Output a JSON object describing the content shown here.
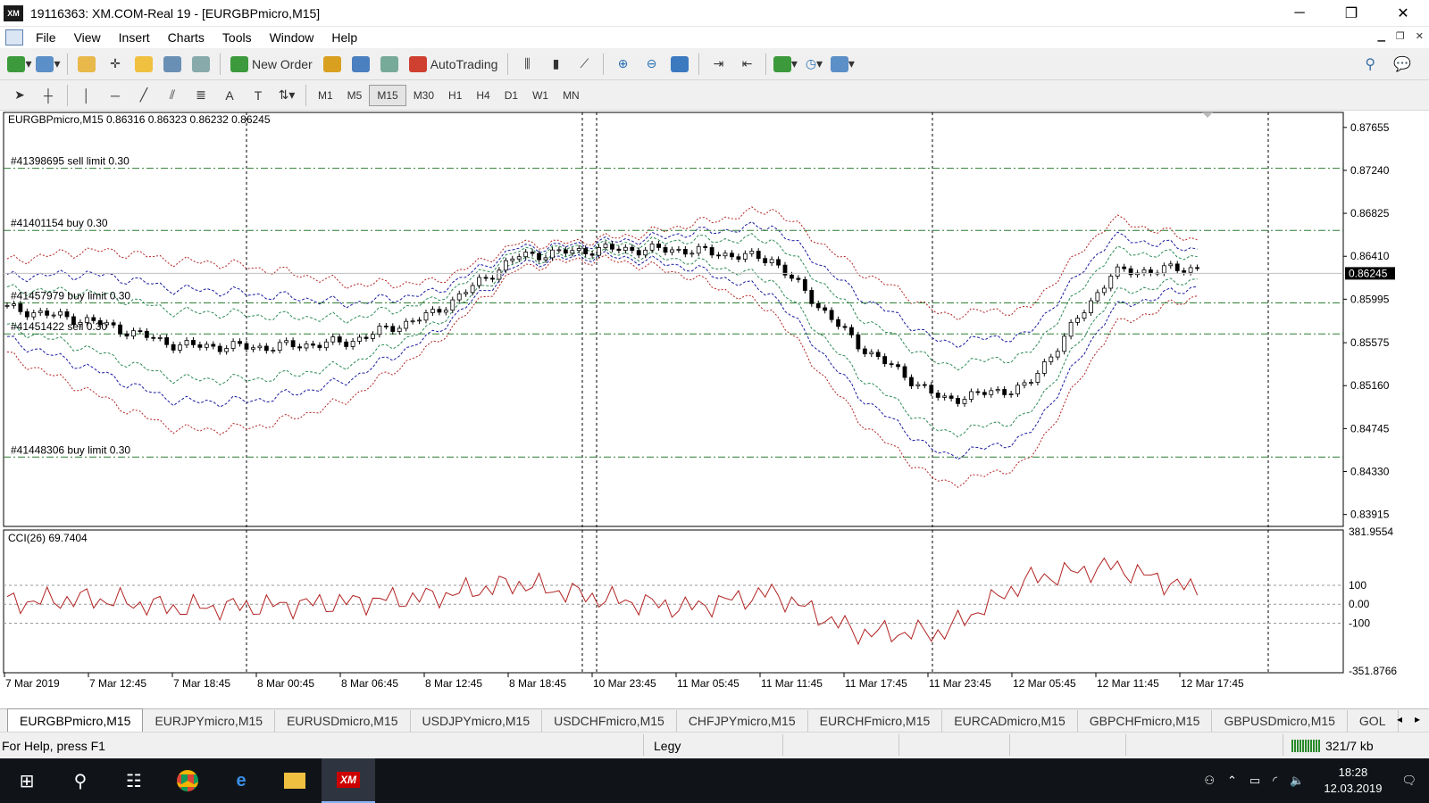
{
  "window": {
    "title": "19116363: XM.COM-Real 19 - [EURGBPmicro,M15]",
    "app_icon_text": "XM",
    "controls": [
      "─",
      "❐",
      "✕"
    ]
  },
  "menu": [
    "File",
    "View",
    "Insert",
    "Charts",
    "Tools",
    "Window",
    "Help"
  ],
  "toolbar": {
    "new_order": "New Order",
    "autotrading": "AutoTrading"
  },
  "timeframes": {
    "items": [
      "M1",
      "M5",
      "M15",
      "M30",
      "H1",
      "H4",
      "D1",
      "W1",
      "MN"
    ],
    "active": "M15"
  },
  "chart": {
    "header": "EURGBPmicro,M15  0.86316 0.86323 0.86232 0.86245",
    "current_price": "0.86245",
    "price_ticks": [
      "0.87655",
      "0.87240",
      "0.86825",
      "0.86410",
      "0.85995",
      "0.85575",
      "0.85160",
      "0.84745",
      "0.84330",
      "0.83915"
    ],
    "orders": [
      {
        "label": "#41398695 sell limit 0.30",
        "price": 0.8726
      },
      {
        "label": "#41401154 buy 0.30",
        "price": 0.8666
      },
      {
        "label": "#41457979 buy limit 0.30",
        "price": 0.8596
      },
      {
        "label": "#41451422 sell 0.30",
        "price": 0.8566
      },
      {
        "label": "#41448306 buy limit 0.30",
        "price": 0.8447
      }
    ],
    "price_range": [
      0.838,
      0.878
    ],
    "time_labels": [
      "7 Mar 2019",
      "7 Mar 12:45",
      "7 Mar 18:45",
      "8 Mar 00:45",
      "8 Mar 06:45",
      "8 Mar 12:45",
      "8 Mar 18:45",
      "10 Mar 23:45",
      "11 Mar 05:45",
      "11 Mar 11:45",
      "11 Mar 17:45",
      "11 Mar 23:45",
      "12 Mar 05:45",
      "12 Mar 11:45",
      "12 Mar 17:45"
    ]
  },
  "indicator": {
    "title": "CCI(26) 69.7404",
    "ticks": [
      "381.9554",
      "100",
      "0.00",
      "-100",
      "-351.8766"
    ],
    "range": [
      -351.8766,
      381.9554
    ],
    "color": "#b22222"
  },
  "chart_data": {
    "type": "line",
    "title": "EURGBPmicro,M15",
    "x": [
      "7 Mar 2019",
      "7 Mar 12:45",
      "7 Mar 18:45",
      "8 Mar 00:45",
      "8 Mar 06:45",
      "8 Mar 12:45",
      "8 Mar 18:45",
      "10 Mar 23:45",
      "11 Mar 05:45",
      "11 Mar 11:45",
      "11 Mar 17:45",
      "11 Mar 23:45",
      "12 Mar 05:45",
      "12 Mar 11:45",
      "12 Mar 17:45"
    ],
    "series": [
      {
        "name": "EURGBPmicro,M15",
        "values": [
          0.8591,
          0.8578,
          0.8555,
          0.8553,
          0.8558,
          0.8585,
          0.8641,
          0.8648,
          0.8647,
          0.8638,
          0.8556,
          0.8502,
          0.8515,
          0.8625,
          0.863
        ]
      },
      {
        "name": "CCI(26) 69.7404",
        "values": [
          10,
          30,
          -20,
          -10,
          10,
          40,
          110,
          30,
          -20,
          60,
          -150,
          -150,
          130,
          200,
          70
        ]
      }
    ],
    "ylim": [
      0.838,
      0.878
    ]
  },
  "tabs": {
    "items": [
      "EURGBPmicro,M15",
      "EURJPYmicro,M15",
      "EURUSDmicro,M15",
      "USDJPYmicro,M15",
      "USDCHFmicro,M15",
      "CHFJPYmicro,M15",
      "EURCHFmicro,M15",
      "EURCADmicro,M15",
      "GBPCHFmicro,M15",
      "GBPUSDmicro,M15",
      "GOL"
    ],
    "active": "EURGBPmicro,M15",
    "arrows": [
      "◂",
      "▸"
    ]
  },
  "status": {
    "help": "For Help, press F1",
    "profile": "Legy",
    "traffic": "321/7 kb"
  },
  "taskbar": {
    "time": "18:28",
    "date": "12.03.2019"
  },
  "colors": {
    "candle": "#000000",
    "band_blue": "#1a1aa0",
    "band_red": "#b22222",
    "band_green": "#2e8b57",
    "order_line": "#2e7d32",
    "cci": "#b22222"
  }
}
